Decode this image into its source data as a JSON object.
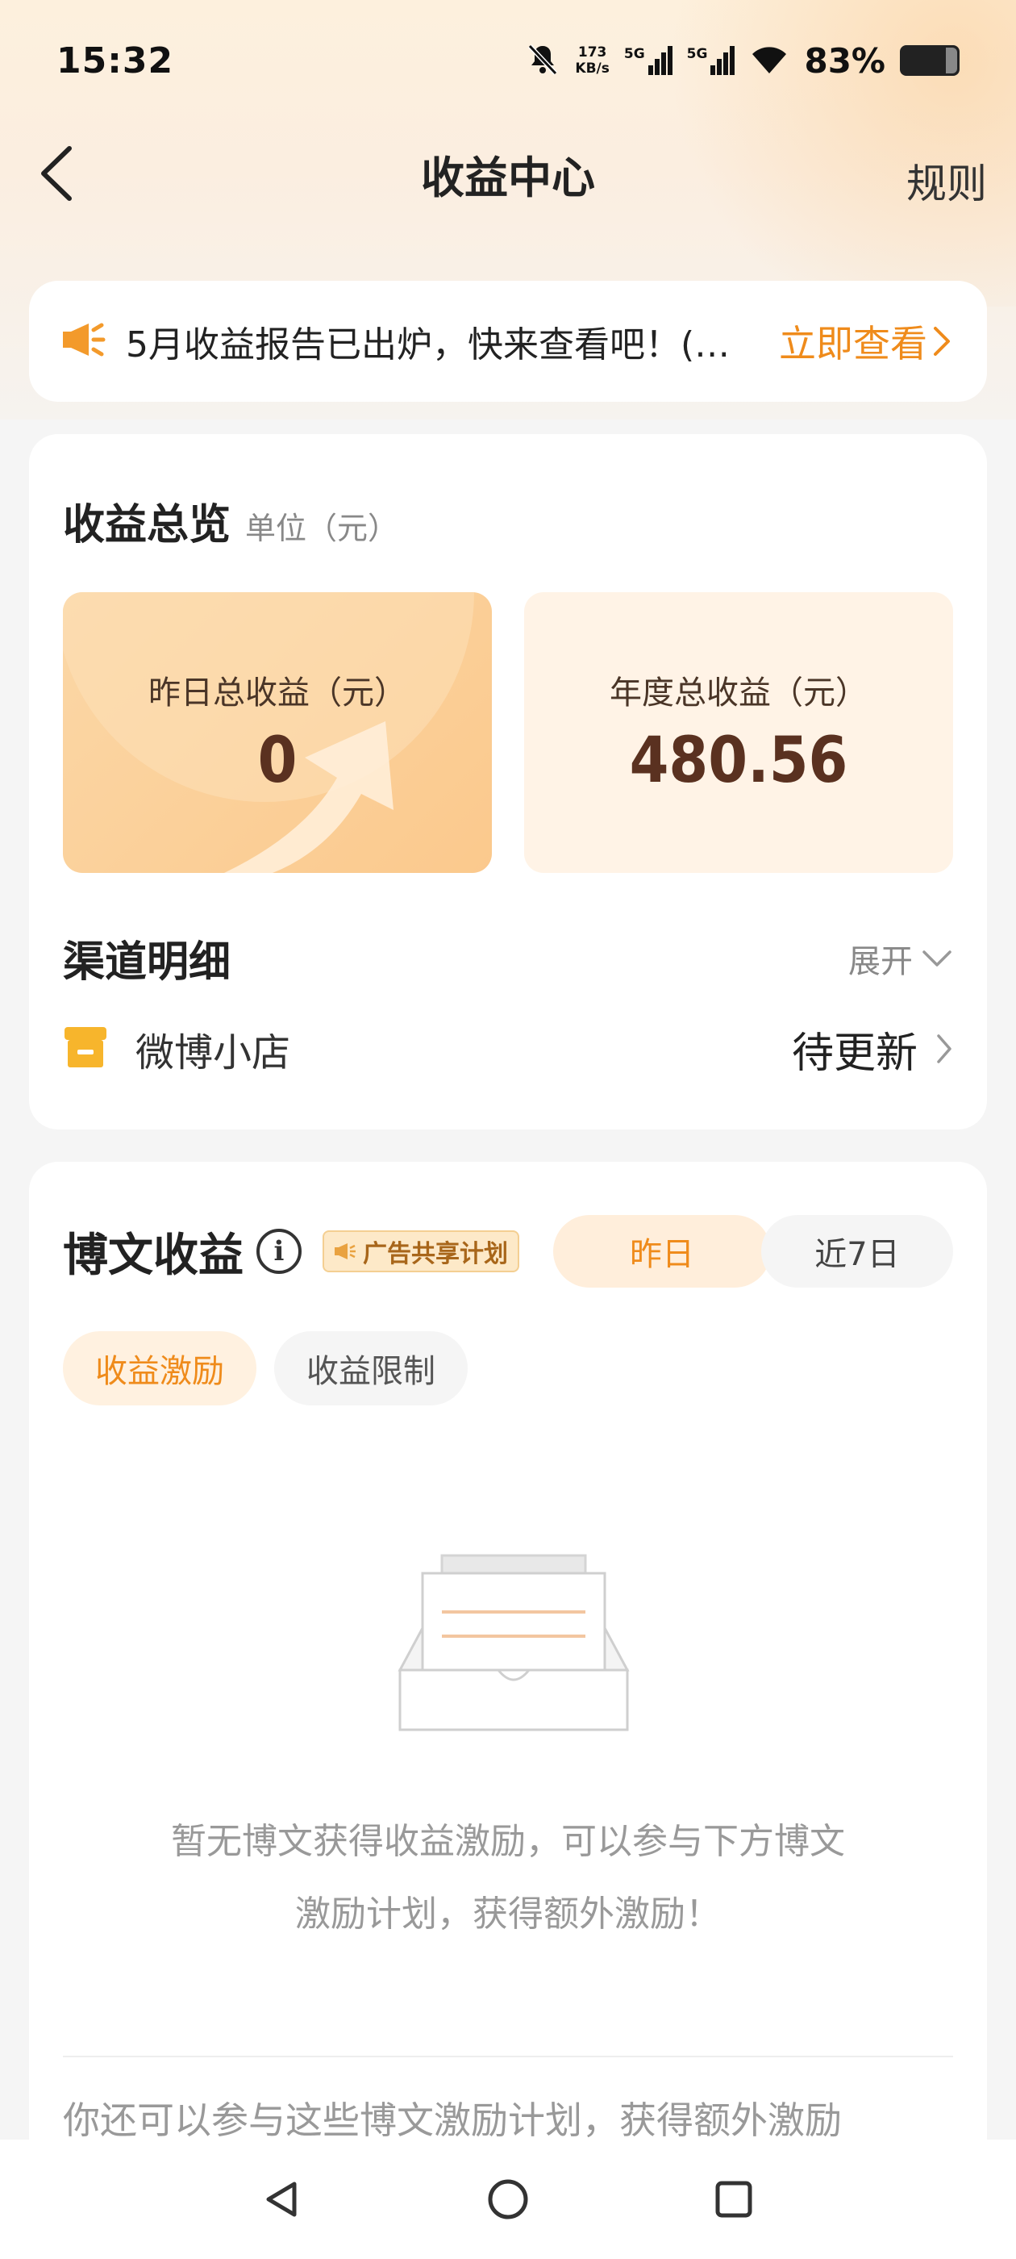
{
  "status_bar": {
    "time": "15:32",
    "net_speed_value": "173",
    "net_speed_unit": "KB/s",
    "signal_1_label": "5G",
    "signal_2_label": "5G",
    "battery": "83%"
  },
  "nav": {
    "title": "收益中心",
    "right_label": "规则"
  },
  "notice": {
    "text": "5月收益报告已出炉，快来查看吧！(…",
    "link_label": "立即查看"
  },
  "overview": {
    "title": "收益总览",
    "unit": "单位（元）",
    "yesterday": {
      "label": "昨日总收益（元）",
      "value": "0"
    },
    "annual": {
      "label": "年度总收益（元）",
      "value": "480.56"
    }
  },
  "channels": {
    "title": "渠道明细",
    "expand_label": "展开",
    "items": [
      {
        "name": "微博小店",
        "status": "待更新"
      }
    ]
  },
  "posts": {
    "title": "博文收益",
    "badge": "广告共享计划",
    "range_tabs": [
      "昨日",
      "近7日"
    ],
    "chips": [
      "收益激励",
      "收益限制"
    ],
    "empty_line1": "暂无博文获得收益激励，可以参与下方博文",
    "empty_line2": "激励计划，获得额外激励！",
    "more_text": "你还可以参与这些博文激励计划，获得额外激励"
  },
  "colors": {
    "accent": "#ef8b1b",
    "value_brown": "#5a3120"
  }
}
